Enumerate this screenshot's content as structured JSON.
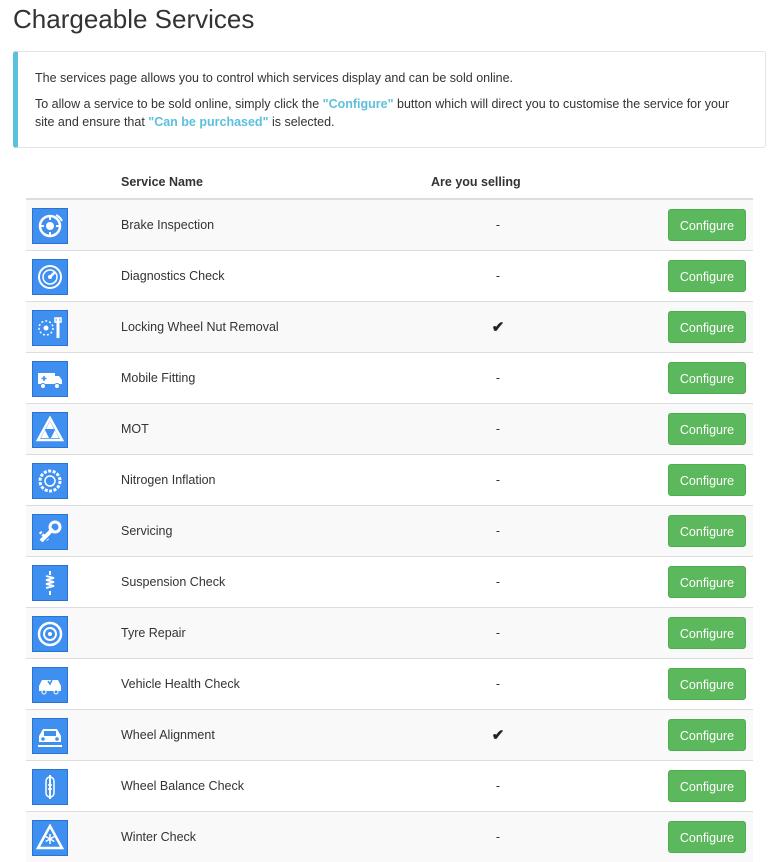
{
  "page": {
    "title": "Chargeable Services"
  },
  "info": {
    "line1": "The services page allows you to control which services display and can be sold online.",
    "line2_before": "To allow a service to be sold online, simply click the ",
    "line2_configure": "\"Configure\"",
    "line2_middle": " button which will direct you to customise the service for your site and ensure that ",
    "line2_purchased": "\"Can be purchased\"",
    "line2_after": " is selected."
  },
  "table": {
    "headers": {
      "name": "Service Name",
      "selling": "Are you selling"
    },
    "button_label": "Configure",
    "rows": [
      {
        "name": "Brake Inspection",
        "selling": "-",
        "icon": "brake-icon"
      },
      {
        "name": "Diagnostics Check",
        "selling": "-",
        "icon": "gauge-icon"
      },
      {
        "name": "Locking Wheel Nut Removal",
        "selling": "✔",
        "icon": "wheel-nut-wrench-icon"
      },
      {
        "name": "Mobile Fitting",
        "selling": "-",
        "icon": "van-icon"
      },
      {
        "name": "MOT",
        "selling": "-",
        "icon": "mot-triangle-icon"
      },
      {
        "name": "Nitrogen Inflation",
        "selling": "-",
        "icon": "nitrogen-tyre-icon"
      },
      {
        "name": "Servicing",
        "selling": "-",
        "icon": "wrench-icon"
      },
      {
        "name": "Suspension Check",
        "selling": "-",
        "icon": "suspension-spring-icon"
      },
      {
        "name": "Tyre Repair",
        "selling": "-",
        "icon": "tyre-icon"
      },
      {
        "name": "Vehicle Health Check",
        "selling": "-",
        "icon": "car-health-icon"
      },
      {
        "name": "Wheel Alignment",
        "selling": "✔",
        "icon": "car-front-icon"
      },
      {
        "name": "Wheel Balance Check",
        "selling": "-",
        "icon": "balance-icon"
      },
      {
        "name": "Winter Check",
        "selling": "-",
        "icon": "snow-warning-icon"
      }
    ]
  },
  "colors": {
    "accent": "#5bc0de",
    "button": "#5cb85c",
    "icon_bg": "#3f8ff0"
  }
}
